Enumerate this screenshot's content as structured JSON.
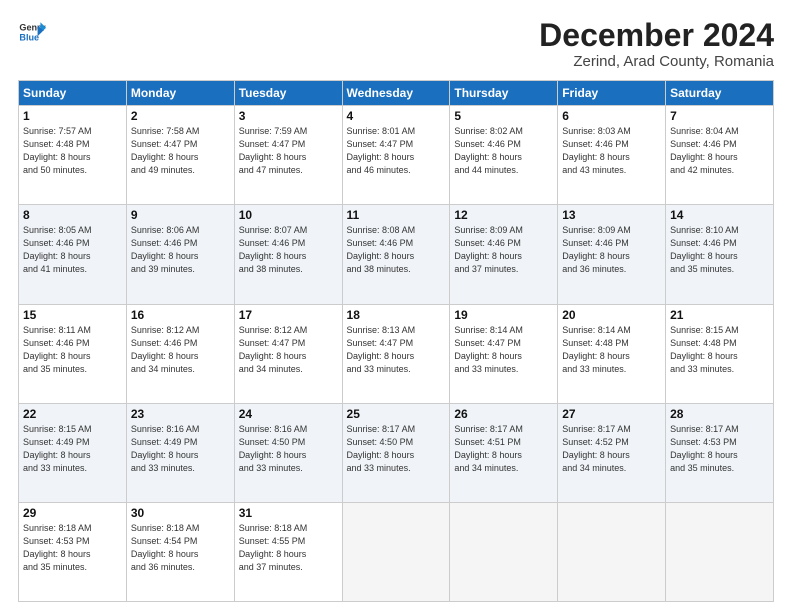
{
  "header": {
    "logo_line1": "General",
    "logo_line2": "Blue",
    "title": "December 2024",
    "subtitle": "Zerind, Arad County, Romania"
  },
  "weekdays": [
    "Sunday",
    "Monday",
    "Tuesday",
    "Wednesday",
    "Thursday",
    "Friday",
    "Saturday"
  ],
  "weeks": [
    [
      {
        "day": "1",
        "rise": "7:57 AM",
        "set": "4:48 PM",
        "daylight": "8 hours and 50 minutes."
      },
      {
        "day": "2",
        "rise": "7:58 AM",
        "set": "4:47 PM",
        "daylight": "8 hours and 49 minutes."
      },
      {
        "day": "3",
        "rise": "7:59 AM",
        "set": "4:47 PM",
        "daylight": "8 hours and 47 minutes."
      },
      {
        "day": "4",
        "rise": "8:01 AM",
        "set": "4:47 PM",
        "daylight": "8 hours and 46 minutes."
      },
      {
        "day": "5",
        "rise": "8:02 AM",
        "set": "4:46 PM",
        "daylight": "8 hours and 44 minutes."
      },
      {
        "day": "6",
        "rise": "8:03 AM",
        "set": "4:46 PM",
        "daylight": "8 hours and 43 minutes."
      },
      {
        "day": "7",
        "rise": "8:04 AM",
        "set": "4:46 PM",
        "daylight": "8 hours and 42 minutes."
      }
    ],
    [
      {
        "day": "8",
        "rise": "8:05 AM",
        "set": "4:46 PM",
        "daylight": "8 hours and 41 minutes."
      },
      {
        "day": "9",
        "rise": "8:06 AM",
        "set": "4:46 PM",
        "daylight": "8 hours and 39 minutes."
      },
      {
        "day": "10",
        "rise": "8:07 AM",
        "set": "4:46 PM",
        "daylight": "8 hours and 38 minutes."
      },
      {
        "day": "11",
        "rise": "8:08 AM",
        "set": "4:46 PM",
        "daylight": "8 hours and 38 minutes."
      },
      {
        "day": "12",
        "rise": "8:09 AM",
        "set": "4:46 PM",
        "daylight": "8 hours and 37 minutes."
      },
      {
        "day": "13",
        "rise": "8:09 AM",
        "set": "4:46 PM",
        "daylight": "8 hours and 36 minutes."
      },
      {
        "day": "14",
        "rise": "8:10 AM",
        "set": "4:46 PM",
        "daylight": "8 hours and 35 minutes."
      }
    ],
    [
      {
        "day": "15",
        "rise": "8:11 AM",
        "set": "4:46 PM",
        "daylight": "8 hours and 35 minutes."
      },
      {
        "day": "16",
        "rise": "8:12 AM",
        "set": "4:46 PM",
        "daylight": "8 hours and 34 minutes."
      },
      {
        "day": "17",
        "rise": "8:12 AM",
        "set": "4:47 PM",
        "daylight": "8 hours and 34 minutes."
      },
      {
        "day": "18",
        "rise": "8:13 AM",
        "set": "4:47 PM",
        "daylight": "8 hours and 33 minutes."
      },
      {
        "day": "19",
        "rise": "8:14 AM",
        "set": "4:47 PM",
        "daylight": "8 hours and 33 minutes."
      },
      {
        "day": "20",
        "rise": "8:14 AM",
        "set": "4:48 PM",
        "daylight": "8 hours and 33 minutes."
      },
      {
        "day": "21",
        "rise": "8:15 AM",
        "set": "4:48 PM",
        "daylight": "8 hours and 33 minutes."
      }
    ],
    [
      {
        "day": "22",
        "rise": "8:15 AM",
        "set": "4:49 PM",
        "daylight": "8 hours and 33 minutes."
      },
      {
        "day": "23",
        "rise": "8:16 AM",
        "set": "4:49 PM",
        "daylight": "8 hours and 33 minutes."
      },
      {
        "day": "24",
        "rise": "8:16 AM",
        "set": "4:50 PM",
        "daylight": "8 hours and 33 minutes."
      },
      {
        "day": "25",
        "rise": "8:17 AM",
        "set": "4:50 PM",
        "daylight": "8 hours and 33 minutes."
      },
      {
        "day": "26",
        "rise": "8:17 AM",
        "set": "4:51 PM",
        "daylight": "8 hours and 34 minutes."
      },
      {
        "day": "27",
        "rise": "8:17 AM",
        "set": "4:52 PM",
        "daylight": "8 hours and 34 minutes."
      },
      {
        "day": "28",
        "rise": "8:17 AM",
        "set": "4:53 PM",
        "daylight": "8 hours and 35 minutes."
      }
    ],
    [
      {
        "day": "29",
        "rise": "8:18 AM",
        "set": "4:53 PM",
        "daylight": "8 hours and 35 minutes."
      },
      {
        "day": "30",
        "rise": "8:18 AM",
        "set": "4:54 PM",
        "daylight": "8 hours and 36 minutes."
      },
      {
        "day": "31",
        "rise": "8:18 AM",
        "set": "4:55 PM",
        "daylight": "8 hours and 37 minutes."
      },
      null,
      null,
      null,
      null
    ]
  ]
}
